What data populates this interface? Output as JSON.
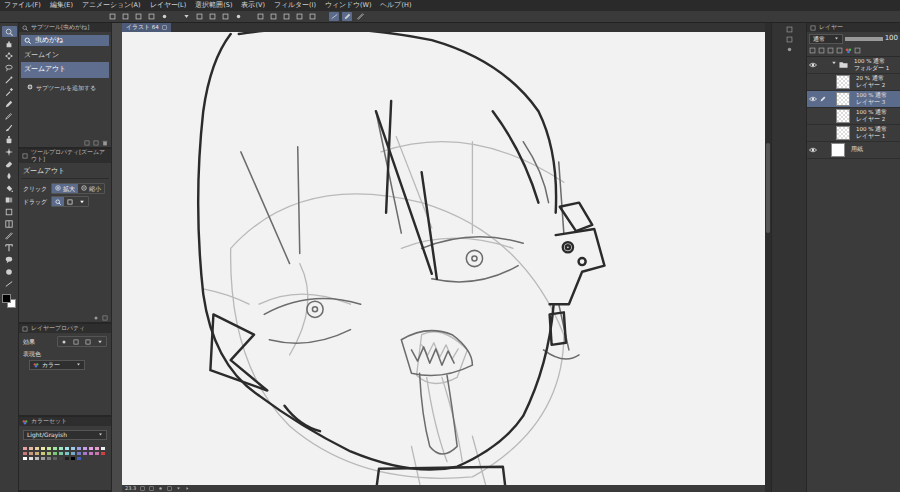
{
  "menu": [
    "ファイル(F)",
    "編集(E)",
    "アニメーション(A)",
    "レイヤー(L)",
    "選択範囲(S)",
    "表示(V)",
    "フィルター(I)",
    "ウィンドウ(W)",
    "ヘルプ(H)"
  ],
  "toolbar": [
    {
      "selected": false
    },
    {
      "selected": false
    },
    {
      "selected": false
    },
    {
      "selected": false
    },
    {
      "selected": false
    },
    {
      "selected": false
    },
    {
      "selected": false
    },
    {
      "selected": false
    },
    {
      "selected": false
    },
    {
      "selected": false
    },
    {
      "selected": false
    },
    {
      "selected": false
    },
    {
      "selected": false
    },
    {
      "selected": false
    },
    {
      "selected": false
    },
    {
      "selected": true
    },
    {
      "selected": true
    },
    {
      "selected": false
    }
  ],
  "tools": [
    {
      "selected": true
    },
    {
      "selected": false
    },
    {
      "selected": false
    },
    {
      "selected": false
    },
    {
      "selected": false
    },
    {
      "selected": false
    },
    {
      "selected": false
    },
    {
      "selected": false
    },
    {
      "selected": false
    },
    {
      "selected": false
    },
    {
      "selected": false
    },
    {
      "selected": false
    },
    {
      "selected": false
    },
    {
      "selected": false
    },
    {
      "selected": false
    },
    {
      "selected": false
    },
    {
      "selected": false
    },
    {
      "selected": false
    },
    {
      "selected": false
    },
    {
      "selected": false
    },
    {
      "selected": false
    },
    {
      "selected": false
    }
  ],
  "colors": {
    "main": "#000000",
    "sub": "#ffffff"
  },
  "subtool_panel": {
    "title": "サブツール[虫めがね]",
    "group": "虫めがね",
    "items": [
      {
        "label": "ズームイン",
        "selected": false
      },
      {
        "label": "ズームアウト",
        "selected": true
      }
    ],
    "add": "サブツールを追加する"
  },
  "tool_property": {
    "title": "ツールプロパティ[ズームアウト]",
    "name": "ズームアウト",
    "click": {
      "label": "クリック",
      "options": [
        {
          "label": "拡大",
          "selected": true
        },
        {
          "label": "縮小",
          "selected": false
        }
      ]
    },
    "drag": {
      "label": "ドラッグ",
      "options": [
        {
          "selected": true
        },
        {
          "selected": false
        },
        {
          "selected": false
        }
      ]
    }
  },
  "layer_property": {
    "title": "レイヤープロパティ",
    "effect_label": "効果",
    "color_label": "表現色",
    "color_value": "カラー"
  },
  "color_set": {
    "title": "カラーセット",
    "name": "Light/Grayish",
    "swatches": [
      "#e8a0a0",
      "#e8b8a0",
      "#e8d0a0",
      "#e8e8a0",
      "#c8e8a0",
      "#a0e8a0",
      "#a0e8c8",
      "#a0e8e8",
      "#a0c8e8",
      "#a0a0e8",
      "#c8a0e8",
      "#e8a0e8",
      "#e8a0c8",
      "#f0f0f0",
      "#c87878",
      "#c89878",
      "#c8b078",
      "#c8c878",
      "#a8c878",
      "#78c878",
      "#78c8a8",
      "#78c8c8",
      "#78a8c8",
      "#7878c8",
      "#a878c8",
      "#c878c8",
      "#c878a8",
      "#d04040",
      "#ffffff",
      "#e0e0e0",
      "#c0c0c0",
      "#a0a0a0",
      "#808080",
      "#606060",
      "#404040",
      "#202020",
      "#000000",
      "#4060c0"
    ]
  },
  "document_tab": {
    "label": "イラスト 64"
  },
  "layers_panel": {
    "title": "レイヤー",
    "blend": "通常",
    "opacity": "100",
    "opacity_level": 1.0,
    "layers": [
      {
        "info": "100 % 通常",
        "name": "フォルダー 1",
        "kind": "folder",
        "visible": true,
        "selected": false,
        "editing": false,
        "expanded": true
      },
      {
        "info": "20 % 通常",
        "name": "レイヤー 2",
        "kind": "raster",
        "visible": false,
        "selected": false,
        "editing": false
      },
      {
        "info": "100 % 通常",
        "name": "レイヤー 3",
        "kind": "raster",
        "visible": true,
        "selected": true,
        "editing": true
      },
      {
        "info": "100 % 通常",
        "name": "レイヤー 2",
        "kind": "raster",
        "visible": false,
        "selected": false,
        "editing": false
      },
      {
        "info": "100 % 通常",
        "name": "レイヤー 1",
        "kind": "raster",
        "visible": false,
        "selected": false,
        "editing": false
      },
      {
        "name": "用紙",
        "kind": "paper",
        "visible": true,
        "selected": false,
        "editing": false
      }
    ]
  },
  "status_bar": {
    "zoom": "23.3"
  }
}
